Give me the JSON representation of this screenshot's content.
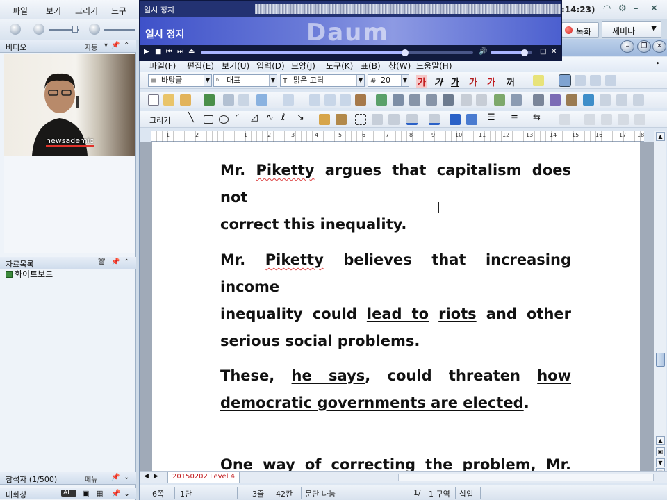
{
  "host": {
    "menu": [
      "파일",
      "보기",
      "그리기",
      "도구"
    ],
    "time": ":14:23)",
    "record_label": "녹화",
    "seminar_label": "세미나",
    "video_panel": {
      "title": "비디오",
      "mode": "자동",
      "speaker_label": "newsademic"
    },
    "materials_panel": {
      "title": "자료목록",
      "item": "화이트보드"
    },
    "participants_panel": {
      "title": "참석자 (1/500)",
      "menu_label": "메뉴"
    },
    "chat_panel": {
      "title": "대화창",
      "badge": "ALL"
    }
  },
  "player": {
    "title": "일시 정지",
    "banner_text": "일시 정지",
    "logo_text": "Daum",
    "seek_fraction": 0.75,
    "volume_fraction": 0.82
  },
  "hwp": {
    "menu": [
      "파일(F)",
      "편집(E)",
      "보기(U)",
      "입력(D)",
      "모양(J)",
      "도구(K)",
      "표(B)",
      "창(W)",
      "도움말(H)"
    ],
    "style_combo": "바탕글",
    "lang_combo": "대표",
    "font_combo": "맑은 고딕",
    "size_combo": "20",
    "drawing_label": "그리기",
    "ruler_numbers": [
      "1",
      "2",
      "1",
      "2",
      "3",
      "4",
      "5",
      "6",
      "7",
      "8",
      "9",
      "10",
      "11",
      "12",
      "13",
      "14",
      "15",
      "16",
      "17",
      "18"
    ],
    "document": {
      "p1": {
        "pre": "Mr. ",
        "name": "Piketty",
        "line1_rest": " argues that capitalism does not",
        "line2": "correct this inequality."
      },
      "p2": {
        "pre": "Mr. ",
        "name": "Piketty",
        "line1_rest": " believes that increasing income",
        "l2a": "inequality could ",
        "l2b": "lead to",
        "l2c": " ",
        "l2d": "riots",
        "l2e": " and other",
        "line3": "serious social problems."
      },
      "p3": {
        "l1a": "These, ",
        "l1b": "he says",
        "l1c": ", could threaten ",
        "l1d": "how",
        "l2a": "democratic governments are elected",
        "l2b": "."
      },
      "p4": {
        "line1": "One way of correcting the problem, Mr."
      }
    },
    "tab_label": "20150202 Level 4",
    "status": {
      "page": "6쪽",
      "section": "1단",
      "line": "3줄",
      "column": "42칸",
      "split": "문단 나눔",
      "pos": "1/",
      "zone": "1 구역",
      "mode": "삽입"
    }
  },
  "colors": {
    "player_bg": "#1a2b66",
    "tab_text": "#c0161a",
    "spell_underline": "#dd4444"
  }
}
